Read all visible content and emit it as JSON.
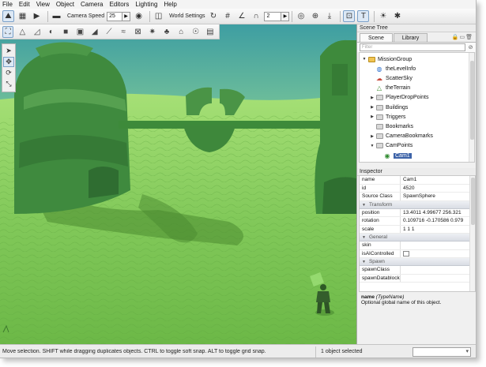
{
  "menu": [
    "File",
    "Edit",
    "View",
    "Object",
    "Camera",
    "Editors",
    "Lighting",
    "Help"
  ],
  "toolbar": {
    "camera_speed_label": "Camera Speed",
    "camera_speed_value": "25",
    "world_settings_label": "World Settings",
    "snap_value": "2"
  },
  "toolbar_icons": [
    "terrain-edit-icon",
    "play-icon",
    "camera-icon",
    "eye-icon",
    "world-settings-icon"
  ],
  "scene_tree": {
    "title": "Scene Tree",
    "tabs": [
      "Scene",
      "Library"
    ],
    "filter_placeholder": "Filter",
    "items": [
      {
        "label": "MissionGroup",
        "depth": 0,
        "icon": "folder-open-icon",
        "expanded": true
      },
      {
        "label": "theLevelInfo",
        "depth": 1,
        "icon": "level-info-icon"
      },
      {
        "label": "ScatterSky",
        "depth": 1,
        "icon": "sky-icon"
      },
      {
        "label": "theTerrain",
        "depth": 1,
        "icon": "terrain-icon"
      },
      {
        "label": "PlayerDropPoints",
        "depth": 1,
        "icon": "folder-icon",
        "collapsed": true
      },
      {
        "label": "Buildings",
        "depth": 1,
        "icon": "folder-icon",
        "collapsed": true
      },
      {
        "label": "Triggers",
        "depth": 1,
        "icon": "folder-icon",
        "collapsed": true
      },
      {
        "label": "Bookmarks",
        "depth": 1,
        "icon": "folder-icon"
      },
      {
        "label": "CameraBookmarks",
        "depth": 1,
        "icon": "folder-icon",
        "collapsed": true
      },
      {
        "label": "CamPoints",
        "depth": 1,
        "icon": "folder-icon",
        "expanded": true
      },
      {
        "label": "Cam1",
        "depth": 2,
        "icon": "spawn-sphere-icon",
        "selected": true
      }
    ]
  },
  "inspector": {
    "title": "Inspector",
    "rows_top": [
      {
        "key": "name",
        "value": "Cam1"
      },
      {
        "key": "id",
        "value": "4520"
      },
      {
        "key": "Source Class",
        "value": "SpawnSphere"
      }
    ],
    "transform_label": "Transform",
    "transform_rows": [
      {
        "key": "position",
        "value": "13.4011 4.99677 256.321"
      },
      {
        "key": "rotation",
        "value": "0.109716 -0.170586 0.979"
      },
      {
        "key": "scale",
        "value": "1 1 1"
      }
    ],
    "general_label": "General",
    "general_rows": [
      {
        "key": "skin",
        "value": ""
      },
      {
        "key": "isAIControlled",
        "value": "",
        "checkbox": true
      }
    ],
    "spawn_label": "Spawn",
    "spawn_rows": [
      {
        "key": "spawnClass",
        "value": ""
      },
      {
        "key": "spawnDatablock",
        "value": ""
      }
    ],
    "help_name": "name",
    "help_type": "(TypeName)",
    "help_text": "Optional global name of this object."
  },
  "status": {
    "message": "Move selection.  SHIFT while dragging duplicates objects.  CTRL to toggle soft snap.  ALT to toggle grid snap.",
    "selection": "1 object selected"
  }
}
